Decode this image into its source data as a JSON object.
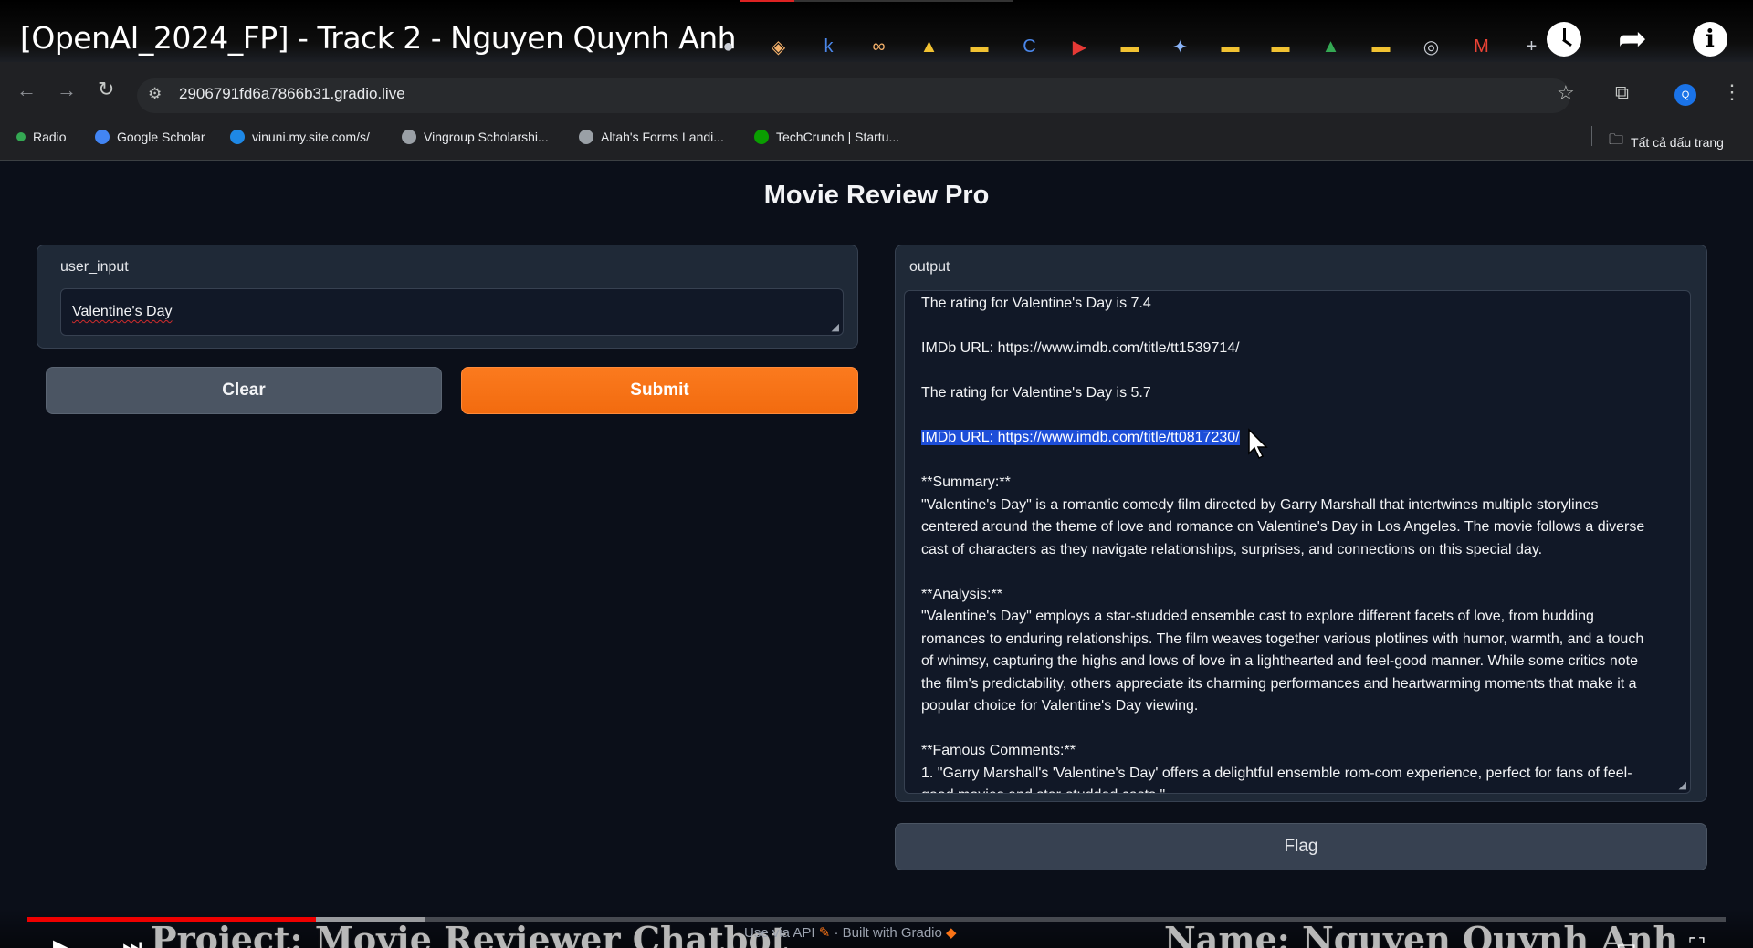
{
  "video": {
    "title": "[OpenAI_2024_FP] - Track 2 - Nguyen Quynh Anh",
    "caption_left": "Project: Movie Reviewer Chatbot",
    "caption_right": "Name: Nguyen Quynh Anh",
    "progress": 0.17
  },
  "browser": {
    "url": "2906791fd6a7866b31.gradio.live",
    "profile_initial": "Q",
    "bookmarks": [
      {
        "label": "Radio",
        "color": "#34a853"
      },
      {
        "label": "Google Scholar",
        "color": "#4285f4"
      },
      {
        "label": "vinuni.my.site.com/s/",
        "color": "#1e88e5"
      },
      {
        "label": "Vingroup Scholarshi...",
        "color": "#9aa0a6"
      },
      {
        "label": "Altah's Forms Landi...",
        "color": "#9aa0a6"
      },
      {
        "label": "TechCrunch | Startu...",
        "color": "#0a9e01"
      }
    ],
    "all_bookmarks": "Tất cả dấu trang",
    "tab_icons": [
      "github-icon",
      "layers-icon",
      "k-icon",
      "infinity-icon",
      "folder-icon",
      "doc-icon",
      "c-icon",
      "youtube-icon",
      "doc-icon",
      "gemini-icon",
      "doc-icon",
      "doc-icon",
      "drive-icon",
      "doc-icon",
      "chrome-icon",
      "gmail-icon",
      "plus-icon"
    ]
  },
  "app": {
    "title": "Movie Review Pro",
    "input_label": "user_input",
    "input_value": "Valentine's Day",
    "clear_label": "Clear",
    "submit_label": "Submit",
    "output_label": "output",
    "flag_label": "Flag",
    "output_lines": [
      "The rating for Valentine's Day is 7.4",
      "",
      "IMDb URL: https://www.imdb.com/title/tt1539714/",
      "",
      "The rating for Valentine's Day is 5.7",
      "",
      "IMDb URL: https://www.imdb.com/title/tt0817230/",
      "",
      "**Summary:**",
      "\"Valentine's Day\" is a romantic comedy film directed by Garry Marshall that intertwines multiple storylines",
      "centered around the theme of love and romance on Valentine's Day in Los Angeles. The movie follows a diverse",
      "cast of characters as they navigate relationships, surprises, and connections on this special day.",
      "",
      "**Analysis:**",
      "\"Valentine's Day\" employs a star-studded ensemble cast to explore different facets of love, from budding",
      "romances to enduring relationships. The film weaves together various plotlines with humor, warmth, and a touch",
      "of whimsy, capturing the highs and lows of love in a lighthearted and feel-good manner. While some critics note",
      "the film's predictability, others appreciate its charming performances and heartwarming moments that make it a",
      "popular choice for Valentine's Day viewing.",
      "",
      "**Famous Comments:**",
      "1. \"Garry Marshall's 'Valentine's Day' offers a delightful ensemble rom-com experience, perfect for fans of feel-",
      "good movies and star-studded casts.\""
    ],
    "highlighted_line": 6,
    "footer_api": "Use via API",
    "footer_built": "Built with Gradio"
  }
}
